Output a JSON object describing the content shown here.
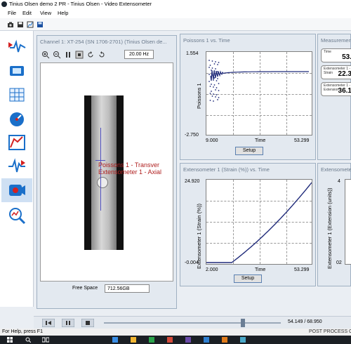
{
  "window": {
    "title": "Tinius Olsen demo 2 PR - Tinius Olsen - Video Extensometer"
  },
  "menu": {
    "items": [
      "File",
      "Edit",
      "View",
      "Help"
    ]
  },
  "toolbar": {
    "icons": [
      "camera-icon",
      "save-icon",
      "chart-icon",
      "disk-icon"
    ]
  },
  "sidebar": {
    "items": [
      {
        "name": "test-setup",
        "selected": false
      },
      {
        "name": "camera-setup",
        "selected": false
      },
      {
        "name": "calibration",
        "selected": false
      },
      {
        "name": "speed",
        "selected": false
      },
      {
        "name": "curve",
        "selected": false
      },
      {
        "name": "signal",
        "selected": false
      },
      {
        "name": "video-record",
        "selected": true
      },
      {
        "name": "analysis",
        "selected": false
      }
    ]
  },
  "channel_panel": {
    "title": "Channel 1: XT-254 (SN 1706-2701) (Tinius Olsen de...",
    "frame_rate": "20.00 Hz",
    "overlay_label_1": "Poissons 1 - Transver",
    "overlay_label_2": "Extensometer 1 - Axial",
    "free_space_label": "Free Space",
    "free_space_value": "712.56GB"
  },
  "poisson_panel": {
    "title": "Poissons 1 vs. Time",
    "ymax": "1.554",
    "ymin": "-2.750",
    "xmin": "9.000",
    "xmax": "53.299",
    "xlabel": "Time",
    "ylabel": "Poissons 1",
    "setup_label": "Setup"
  },
  "strain_panel": {
    "title": "Extensometer 1 (Strain (%)) vs. Time",
    "ymax": "24.920",
    "ymin": "-0.004",
    "xmin": "2.000",
    "xmax": "53.299",
    "xlabel": "Time",
    "ylabel": "Extensometer 1 (Strain (%))",
    "setup_label": "Setup"
  },
  "measurement_panel": {
    "title": "Measuremen",
    "boxes": [
      {
        "label": "Time",
        "value": "53."
      },
      {
        "label": "Extensometer 1 - Strain",
        "value": "22.3"
      },
      {
        "label": "Extensometer 1 - Extension",
        "value": "36.1"
      }
    ]
  },
  "extension_panel": {
    "title": "Extensometer",
    "ylabel": "Extensometer 1 (Extension (units))",
    "ytick_top": "4",
    "ytick_bottom": "02"
  },
  "playbar": {
    "position": "54.149 / 68.950",
    "progress": 0.785
  },
  "status": {
    "help": "For Help, press F1",
    "right": "POST PROCESS  C"
  },
  "colors": {
    "plot_line": "#1f2a7a",
    "overlay_text": "#b02020",
    "accent": "#1a6fc9"
  }
}
